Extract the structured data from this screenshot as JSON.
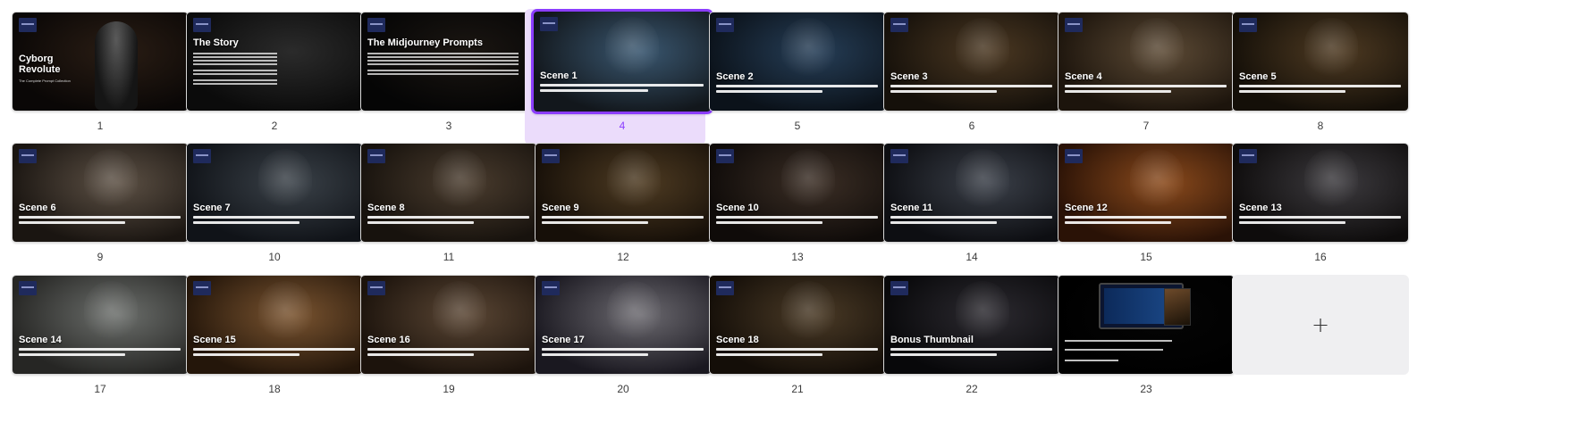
{
  "slides": [
    {
      "number": "1",
      "title": "Cyborg Revolute",
      "subtitle": "The Complete Prompt Collection",
      "kind": "cover",
      "colors": [
        "#2a1d14",
        "#0a0706"
      ]
    },
    {
      "number": "2",
      "title": "The Story",
      "kind": "text",
      "colors": [
        "#2b2b2b",
        "#0b0b0b"
      ]
    },
    {
      "number": "3",
      "title": "The Midjourney Prompts",
      "kind": "text",
      "colors": [
        "#1b1612",
        "#050505"
      ]
    },
    {
      "number": "4",
      "title": "Scene 1",
      "kind": "scene",
      "colors": [
        "#3a5770",
        "#12171c"
      ],
      "selected": true
    },
    {
      "number": "5",
      "title": "Scene 2",
      "kind": "scene",
      "colors": [
        "#263e57",
        "#0b121a"
      ]
    },
    {
      "number": "6",
      "title": "Scene 3",
      "kind": "scene",
      "colors": [
        "#4b3822",
        "#15100a"
      ]
    },
    {
      "number": "7",
      "title": "Scene 4",
      "kind": "scene",
      "colors": [
        "#5c4a35",
        "#1c140c"
      ]
    },
    {
      "number": "8",
      "title": "Scene 5",
      "kind": "scene",
      "colors": [
        "#4e3a22",
        "#140f08"
      ]
    },
    {
      "number": "9",
      "title": "Scene 6",
      "kind": "scene",
      "colors": [
        "#5d5145",
        "#1a1511"
      ]
    },
    {
      "number": "10",
      "title": "Scene 7",
      "kind": "scene",
      "colors": [
        "#3a4148",
        "#101318"
      ]
    },
    {
      "number": "11",
      "title": "Scene 8",
      "kind": "scene",
      "colors": [
        "#4a3c2e",
        "#17120d"
      ]
    },
    {
      "number": "12",
      "title": "Scene 9",
      "kind": "scene",
      "colors": [
        "#4e3b22",
        "#160f08"
      ]
    },
    {
      "number": "13",
      "title": "Scene 10",
      "kind": "scene",
      "colors": [
        "#3b2e25",
        "#0f0b09"
      ]
    },
    {
      "number": "14",
      "title": "Scene 11",
      "kind": "scene",
      "colors": [
        "#3a3f48",
        "#0d0e12"
      ]
    },
    {
      "number": "15",
      "title": "Scene 12",
      "kind": "scene",
      "colors": [
        "#8a4a1c",
        "#2a1206"
      ]
    },
    {
      "number": "16",
      "title": "Scene 13",
      "kind": "scene",
      "colors": [
        "#3c3a3e",
        "#0e0c0c"
      ]
    },
    {
      "number": "17",
      "title": "Scene 14",
      "kind": "scene",
      "colors": [
        "#6c6f6c",
        "#262624"
      ]
    },
    {
      "number": "18",
      "title": "Scene 15",
      "kind": "scene",
      "colors": [
        "#7a5430",
        "#24160a"
      ]
    },
    {
      "number": "19",
      "title": "Scene 16",
      "kind": "scene",
      "colors": [
        "#5a4634",
        "#1c130c"
      ]
    },
    {
      "number": "20",
      "title": "Scene 17",
      "kind": "scene",
      "colors": [
        "#6c6a70",
        "#1a1820"
      ]
    },
    {
      "number": "21",
      "title": "Scene 18",
      "kind": "scene",
      "colors": [
        "#4a3a26",
        "#140e08"
      ]
    },
    {
      "number": "22",
      "title": "Bonus Thumbnail",
      "kind": "scene",
      "colors": [
        "#2c2a30",
        "#08080a"
      ]
    },
    {
      "number": "23",
      "title": "",
      "kind": "outro",
      "colors": [
        "#050505",
        "#000000"
      ]
    }
  ],
  "add_tile": {
    "label": "+"
  }
}
